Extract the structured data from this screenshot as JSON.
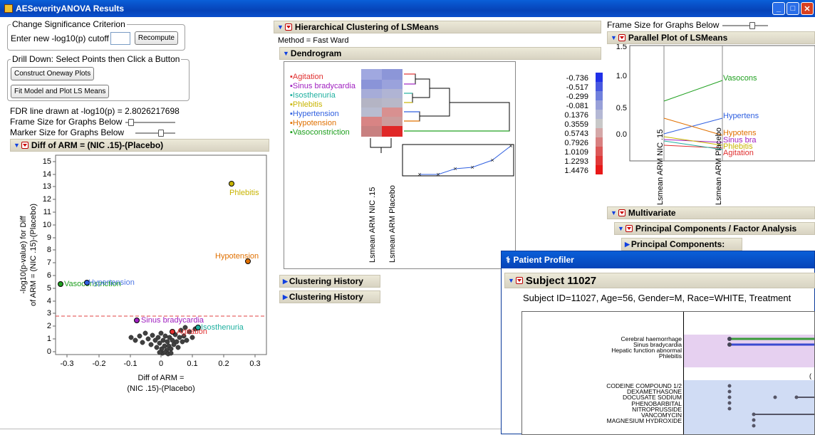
{
  "window": {
    "title": "AESeverityANOVA Results"
  },
  "left": {
    "cutoff_group": {
      "legend": "Change Significance Criterion",
      "label": "Enter new -log10(p) cutoff",
      "input_value": "",
      "button": "Recompute"
    },
    "drill_group": {
      "legend": "Drill Down: Select Points then Click a Button",
      "btn1": "Construct Oneway Plots",
      "btn2": "Fit Model and Plot LS Means"
    },
    "fdr_text": "FDR line drawn at -log10(p) = 2.8026217698",
    "frame_size_label": "Frame Size for Graphs Below",
    "marker_size_label": "Marker Size for Graphs Below",
    "diff_title": "Diff of ARM = (NIC .15)-(Placebo)"
  },
  "volcano": {
    "ylabel1": "-log10(p-value) for Diff",
    "ylabel2": "of ARM = (NIC .15)-(Placebo)",
    "xlabel1": "Diff of ARM =",
    "xlabel2": "(NIC .15)-(Placebo)",
    "yticks": [
      "0",
      "1",
      "2",
      "3",
      "4",
      "5",
      "6",
      "7",
      "8",
      "9",
      "10",
      "11",
      "12",
      "13",
      "14",
      "15"
    ],
    "xticks": [
      "-0.3",
      "-0.2",
      "-0.1",
      "0",
      "0.1",
      "0.2",
      "0.3"
    ],
    "labels": {
      "phlebitis": "Phlebitis",
      "hypotension": "Hypotension",
      "vasohyp": "Vasoconstriction",
      "hyp2": "Hypertension",
      "sinus": "Sinus bradycardia",
      "agit": "Agitation",
      "iso": "Isosthenuria"
    },
    "colors": {
      "phlebitis": "#c8b400",
      "hypotension": "#e07000",
      "vaso": "#20a020",
      "hyper": "#3060e0",
      "sinus": "#a020c0",
      "agit": "#e03030",
      "iso": "#20b0a0"
    }
  },
  "cluster": {
    "title": "Hierarchical Clustering of LSMeans",
    "method": "Method = Fast Ward",
    "dendro_title": "Dendrogram",
    "rows": [
      "Agitation",
      "Sinus bradycardia",
      "Isosthenuria",
      "Phlebitis",
      "Hypertension",
      "Hypotension",
      "Vasoconstriction"
    ],
    "row_colors": [
      "#e03030",
      "#a020c0",
      "#20b0a0",
      "#c8b400",
      "#3060e0",
      "#e07000",
      "#20a020"
    ],
    "cols": [
      "Lsmean ARM NIC .15",
      "Lsmean ARM Placebo"
    ],
    "legend_values": [
      "-0.736",
      "-0.517",
      "-0.299",
      "-0.081",
      "0.1376",
      "0.3559",
      "0.5743",
      "0.7926",
      "1.0109",
      "1.2293",
      "1.4476"
    ],
    "history1": "Clustering History",
    "history2": "Clustering History"
  },
  "right": {
    "frame_size_label": "Frame Size for Graphs Below",
    "parallel_title": "Parallel Plot of LSMeans",
    "yticks": [
      "0.0",
      "0.5",
      "1.0",
      "1.5"
    ],
    "xlabels": [
      "Lsmean ARM NIC .15",
      "Lsmean ARM Placebo"
    ],
    "line_labels": [
      "Vasocons",
      "Hypertens",
      "Hypotens",
      "Sinus bra",
      "Phlebitis",
      "Agitation"
    ],
    "multivariate": "Multivariate",
    "pca": "Principal Components / Factor Analysis",
    "pc": "Principal Components:"
  },
  "profiler": {
    "window_title": "Patient Profiler",
    "subject_title": "Subject 11027",
    "info": "Subject ID=11027, Age=56, Gender=M, Race=WHITE, Treatment",
    "ae_labels": [
      "Cerebral haemorrhage",
      "Sinus bradycardia",
      "Hepatic function abnormal",
      "Phlebitis"
    ],
    "med_labels": [
      "CODEINE COMPOUND 1/2",
      "DEXAMETHASONE",
      "DOCUSATE SODIUM",
      "PHENOBARBITAL",
      "NITROPRUSSIDE",
      "VANCOMYCIN",
      "MAGNESIUM HYDROXIDE"
    ]
  }
}
